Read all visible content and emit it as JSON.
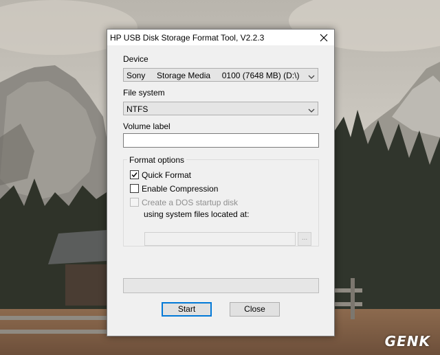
{
  "window": {
    "title": "HP USB Disk Storage Format Tool, V2.2.3",
    "close_icon": "close-icon"
  },
  "device": {
    "label": "Device",
    "selected": "Sony     Storage Media     0100 (7648 MB) (D:\\)"
  },
  "file_system": {
    "label": "File system",
    "selected": "NTFS"
  },
  "volume_label": {
    "label": "Volume label",
    "value": ""
  },
  "format_options": {
    "title": "Format options",
    "quick_format": {
      "label": "Quick Format",
      "checked": true
    },
    "enable_compression": {
      "label": "Enable Compression",
      "checked": false
    },
    "dos_startup": {
      "label": "Create a DOS startup disk",
      "checked": false,
      "enabled": false
    },
    "system_files_label": "using system files located at:",
    "path_value": "",
    "browse_label": "..."
  },
  "progress": {
    "value": 0
  },
  "buttons": {
    "start": "Start",
    "close": "Close"
  },
  "watermark": "GENK",
  "colors": {
    "focus_border": "#0078d7",
    "dialog_bg": "#f0f0f0"
  }
}
